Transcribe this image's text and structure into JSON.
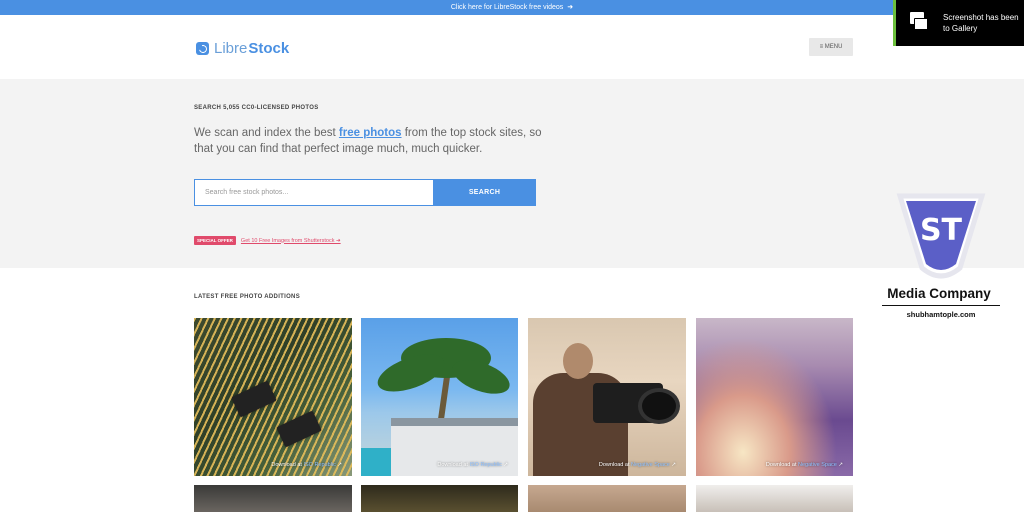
{
  "topbar": {
    "text": "Click here for LibreStock free videos",
    "arrow": "➜"
  },
  "header": {
    "logo_part1": "Libre",
    "logo_part2": "Stock",
    "menu_label": "≡ MENU"
  },
  "hero": {
    "kicker": "SEARCH 5,055 CC0-LICENSED PHOTOS",
    "text_before": "We scan and index the best ",
    "text_link": "free photos",
    "text_after": " from the top stock sites, so that you can find that perfect image much, much quicker.",
    "search_placeholder": "Search free stock photos...",
    "search_button": "SEARCH",
    "offer_badge": "SPECIAL OFFER",
    "offer_link": "Get 10 Free Images from Shutterstock ➜"
  },
  "latest": {
    "title": "LATEST FREE PHOTO ADDITIONS",
    "photos": [
      {
        "prefix": "Download at ",
        "source": "ISO Republic",
        "icon": "↗"
      },
      {
        "prefix": "Download at ",
        "source": "ISO Republic",
        "icon": "↗"
      },
      {
        "prefix": "Download at ",
        "source": "Negative Space",
        "icon": "↗"
      },
      {
        "prefix": "Download at ",
        "source": "Negative Space",
        "icon": "↗"
      }
    ]
  },
  "toast": {
    "line1": "Screenshot has been",
    "line2": "to Gallery"
  },
  "watermark": {
    "letters": "ST",
    "title": "Media Company",
    "subtitle": "shubhamtople.com"
  },
  "colors": {
    "accent": "#4a90e2",
    "offer": "#e04a6b",
    "toast_border": "#6bbf3c",
    "shield": "#5b5fc7"
  }
}
